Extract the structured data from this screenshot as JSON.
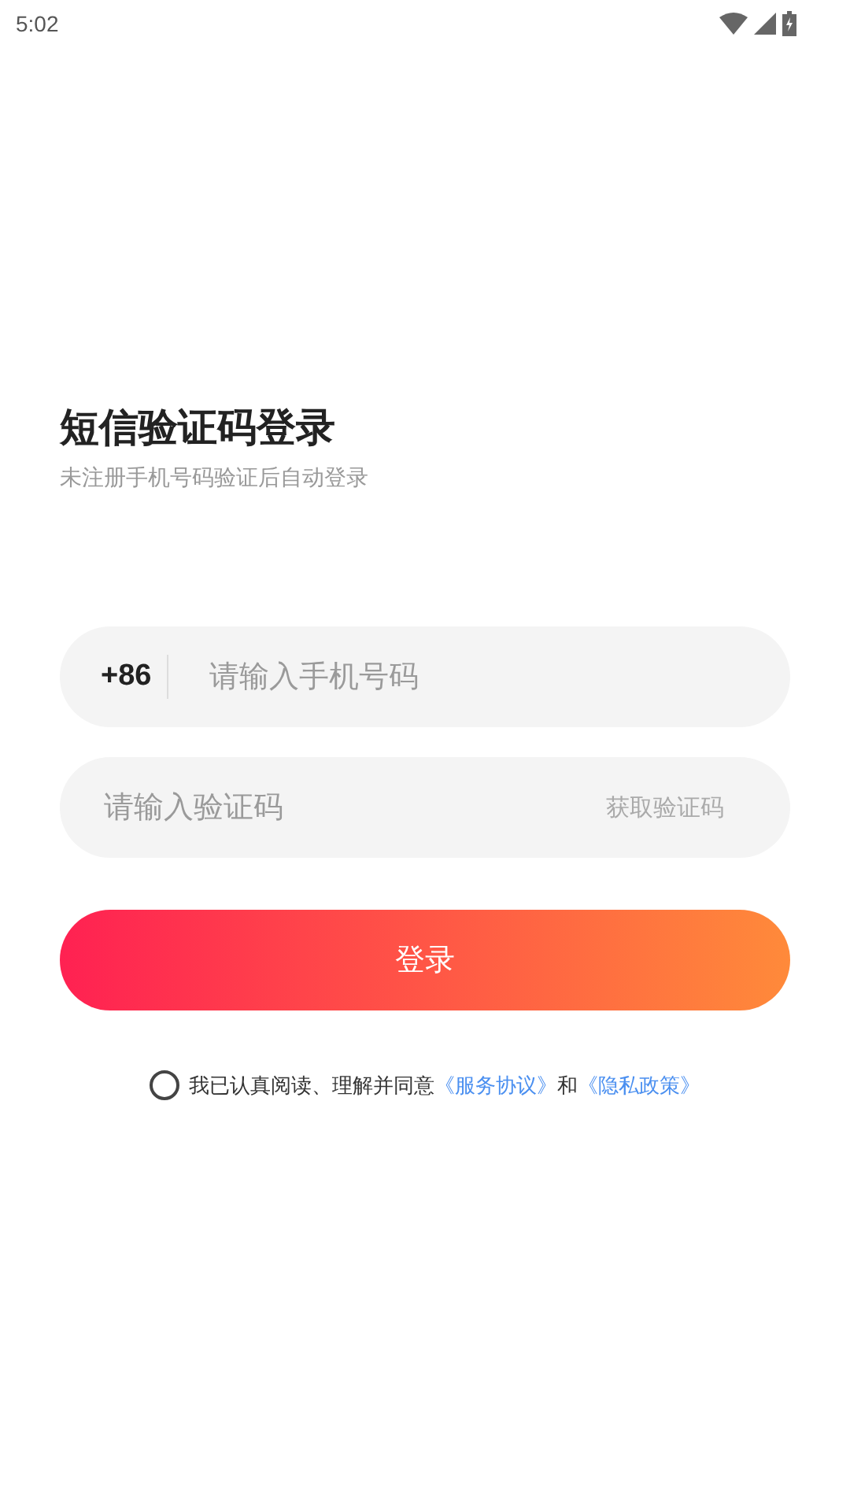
{
  "status_bar": {
    "time": "5:02"
  },
  "title": "短信验证码登录",
  "subtitle": "未注册手机号码验证后自动登录",
  "phone_field": {
    "country_code": "+86",
    "placeholder": "请输入手机号码"
  },
  "code_field": {
    "placeholder": "请输入验证码",
    "action": "获取验证码"
  },
  "login_button": "登录",
  "agreement": {
    "checked": false,
    "parts": [
      {
        "kind": "text",
        "text": "我已认真阅读、理解并同意"
      },
      {
        "kind": "link",
        "text": "《服务协议》"
      },
      {
        "kind": "text",
        "text": "和"
      },
      {
        "kind": "link",
        "text": "《隐私政策》"
      }
    ]
  }
}
